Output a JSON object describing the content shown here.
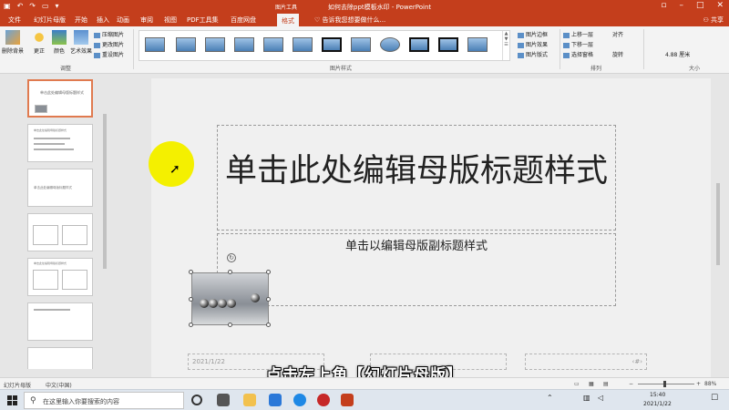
{
  "titlebar": {
    "context_tab": "图片工具",
    "title": "如何去除ppt模板水印 - PowerPoint"
  },
  "tabs": {
    "file": "文件",
    "slide_master": "幻灯片母版",
    "home": "开始",
    "insert": "插入",
    "animations": "动画",
    "review": "审阅",
    "view": "视图",
    "pdf_tools": "PDF工具集",
    "baidu_pan": "百度网盘",
    "format": "格式",
    "tell_me": "告诉我您想要做什么...",
    "share": "共享"
  },
  "ribbon": {
    "remove_background": "删除背景",
    "corrections": "更正",
    "color": "颜色",
    "artistic_effects": "艺术效果",
    "compress_pictures": "压缩图片",
    "change_picture": "更改图片",
    "reset_picture": "重设图片",
    "adjust_group": "调整",
    "picture_styles_group": "图片样式",
    "picture_border": "图片边框",
    "picture_effects": "图片效果",
    "picture_layout": "图片版式",
    "bring_forward": "上移一层",
    "send_backward": "下移一层",
    "selection_pane": "选择窗格",
    "align": "对齐",
    "rotate": "旋转",
    "arrange_group": "排列",
    "size_group": "大小",
    "height_value": "4.88 厘米"
  },
  "thumbnails": [
    {
      "text": "单击此处编辑母版标题样式",
      "selected": true
    },
    {
      "text": "单击此处编辑母版标题样式",
      "selected": false
    },
    {
      "text": "单击此处编辑母版标题样式",
      "selected": false
    },
    {
      "text": "",
      "selected": false
    },
    {
      "text": "单击此处编辑母版标题样式",
      "selected": false
    },
    {
      "text": "",
      "selected": false
    }
  ],
  "slide": {
    "title": "单击此处编辑母版标题样式",
    "subtitle": "单击以编辑母版副标题样式",
    "date": "2021/1/22",
    "page_number": "‹#›"
  },
  "caption": "点击左上角【幻灯片母版】",
  "statusbar": {
    "view_name": "幻灯片母版",
    "language": "中文(中国)",
    "zoom": "88%"
  },
  "taskbar": {
    "search_placeholder": "在这里输入你要搜索的内容",
    "time": "15:40",
    "date": "2021/1/22"
  },
  "colors": {
    "accent": "#c43e1c",
    "highlight": "#f4f000"
  }
}
